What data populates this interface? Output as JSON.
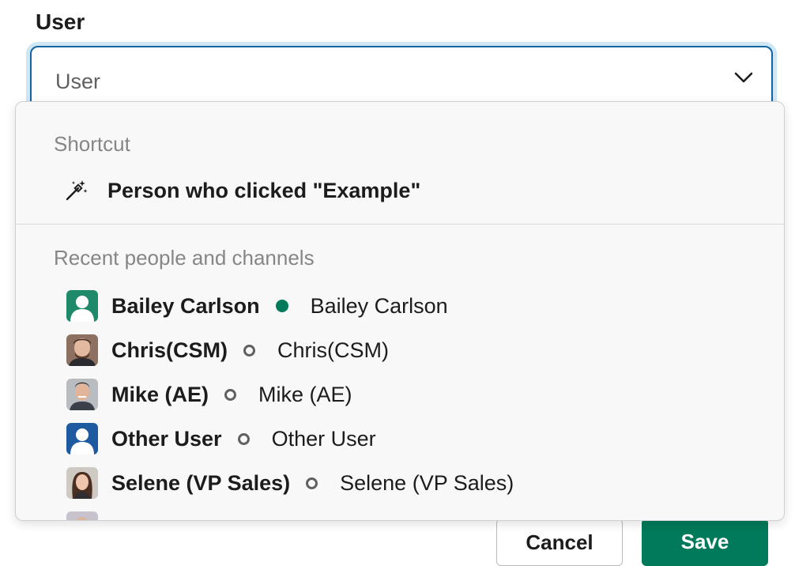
{
  "field": {
    "label": "User",
    "placeholder": "User"
  },
  "footer": {
    "cancel_label": "Cancel",
    "save_label": "Save"
  },
  "dropdown": {
    "shortcut_header": "Shortcut",
    "shortcut_item": {
      "icon": "magic-wand-icon",
      "label": "Person who clicked \"Example\""
    },
    "recent_header": "Recent people and channels",
    "people": [
      {
        "name": "Bailey Carlson",
        "handle": "Bailey Carlson",
        "status": "active",
        "avatar": "default-green"
      },
      {
        "name": "Chris(CSM)",
        "handle": "Chris(CSM)",
        "status": "away",
        "avatar": "photo"
      },
      {
        "name": "Mike (AE)",
        "handle": "Mike (AE)",
        "status": "away",
        "avatar": "photo"
      },
      {
        "name": "Other User",
        "handle": "Other User",
        "status": "away",
        "avatar": "default-blue"
      },
      {
        "name": "Selene (VP Sales)",
        "handle": "Selene (VP Sales)",
        "status": "away",
        "avatar": "photo"
      },
      {
        "name": "",
        "handle": "",
        "status": "active",
        "avatar": "photo"
      }
    ]
  },
  "colors": {
    "accent_blue": "#1264a3",
    "status_active": "#007a5a",
    "save_button": "#007a5a"
  }
}
